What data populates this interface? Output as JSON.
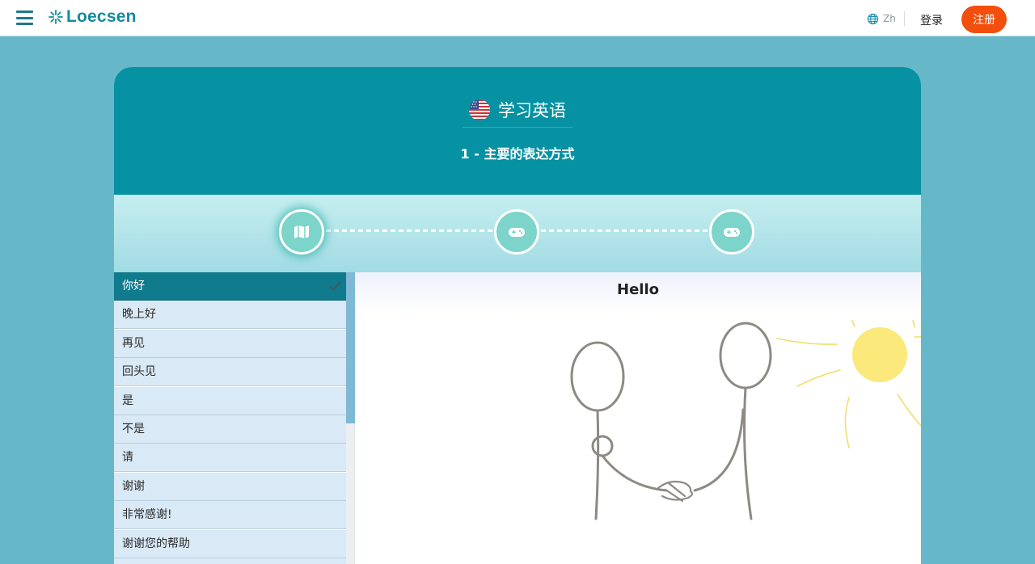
{
  "header": {
    "logo_text": "Loecsen",
    "language": "Zh",
    "login_label": "登录",
    "signup_label": "注册",
    "accent_color": "#148b9d",
    "signup_color": "#f24f0e"
  },
  "course": {
    "title": "学习英语",
    "lesson": "1 - 主要的表达方式",
    "flag_icon": "us-flag-icon"
  },
  "progress": {
    "steps": [
      {
        "icon": "map-icon",
        "state": "active"
      },
      {
        "icon": "gamepad-icon",
        "state": "inactive"
      },
      {
        "icon": "gamepad-icon",
        "state": "inactive"
      }
    ]
  },
  "phrases": {
    "items": [
      {
        "label": "你好",
        "active": true,
        "done": true
      },
      {
        "label": "晚上好"
      },
      {
        "label": "再见"
      },
      {
        "label": "回头见"
      },
      {
        "label": "是"
      },
      {
        "label": "不是"
      },
      {
        "label": "请"
      },
      {
        "label": "谢谢"
      },
      {
        "label": "非常感谢!"
      },
      {
        "label": "谢谢您的帮助"
      }
    ]
  },
  "content": {
    "word": "Hello",
    "illustration": "handshake-illustration"
  }
}
